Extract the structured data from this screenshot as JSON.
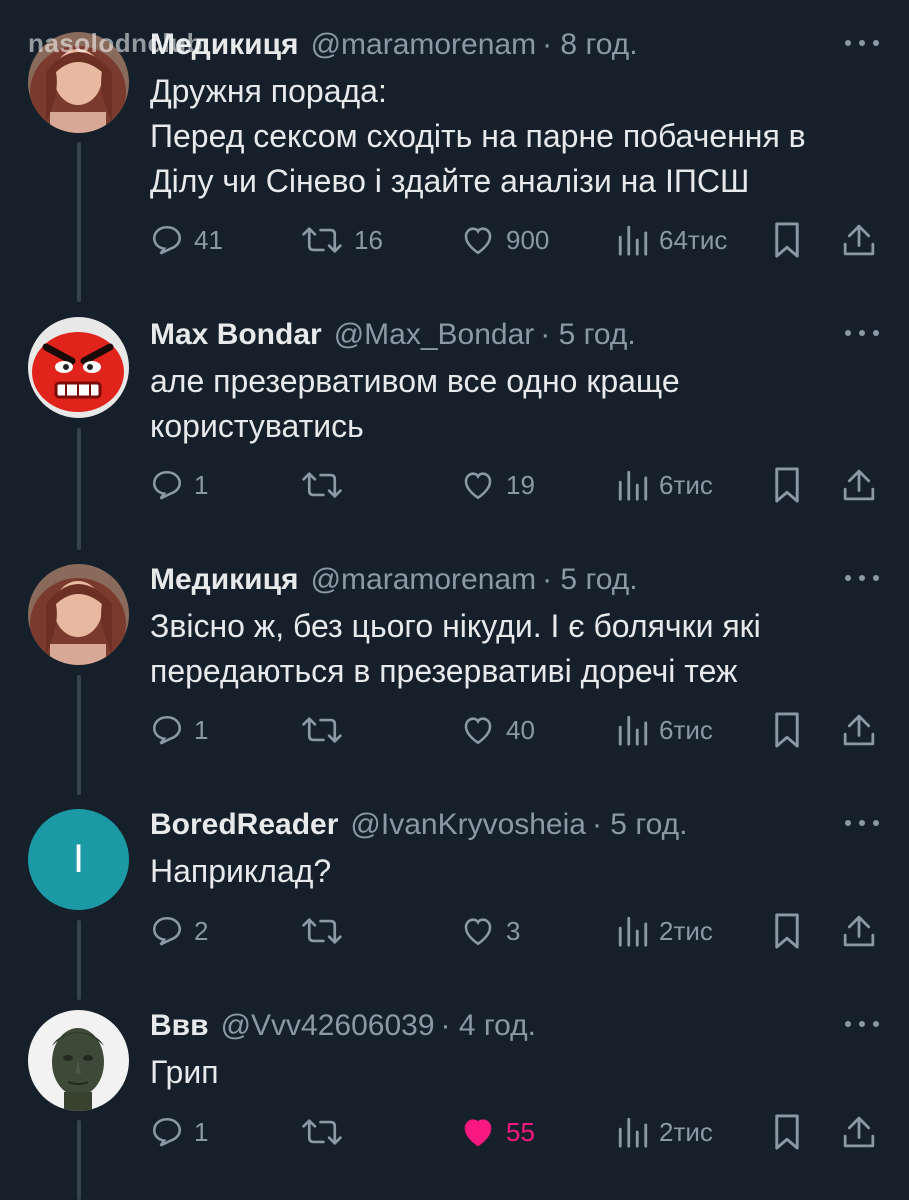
{
  "watermark": "nasolodnclub",
  "tweets": [
    {
      "name": "Медикиця",
      "handle": "@maramorenam",
      "time": "· 8 год.",
      "text_lines": [
        "Дружня порада:",
        "Перед сексом сходіть на парне побачення в",
        "Ділу чи Сінево і здайте аналізи на ІПСШ"
      ],
      "replies": "41",
      "retweets": "16",
      "likes": "900",
      "views": "64тис",
      "liked": false
    },
    {
      "name": "Max Bondar",
      "handle": "@Max_Bondar",
      "time": "· 5 год.",
      "text_lines": [
        "але презервативом все одно краще",
        "користуватись"
      ],
      "replies": "1",
      "retweets": "",
      "likes": "19",
      "views": "6тис",
      "liked": false
    },
    {
      "name": "Медикиця",
      "handle": "@maramorenam",
      "time": "· 5 год.",
      "text_lines": [
        "Звісно ж, без цього нікуди.  І є болячки які",
        "передаються в презервативі доречі теж"
      ],
      "replies": "1",
      "retweets": "",
      "likes": "40",
      "views": "6тис",
      "liked": false
    },
    {
      "name": "BoredReader",
      "handle": "@IvanKryvosheia",
      "time": "· 5 год.",
      "text_lines": [
        "Наприклад?"
      ],
      "replies": "2",
      "retweets": "",
      "likes": "3",
      "views": "2тис",
      "liked": false,
      "avatar_letter": "I"
    },
    {
      "name": "Ввв",
      "handle": "@Vvv42606039",
      "time": "· 4 год.",
      "text_lines": [
        "Грип"
      ],
      "replies": "1",
      "retweets": "",
      "likes": "55",
      "views": "2тис",
      "liked": true
    }
  ],
  "colors": {
    "background": "#15202b",
    "text": "#e7e9ea",
    "muted": "#8b98a5",
    "like_active": "#f91880",
    "thread_line": "#38444d"
  },
  "icons": [
    "reply-icon",
    "retweet-icon",
    "like-icon",
    "views-icon",
    "bookmark-icon",
    "share-icon",
    "more-icon"
  ]
}
